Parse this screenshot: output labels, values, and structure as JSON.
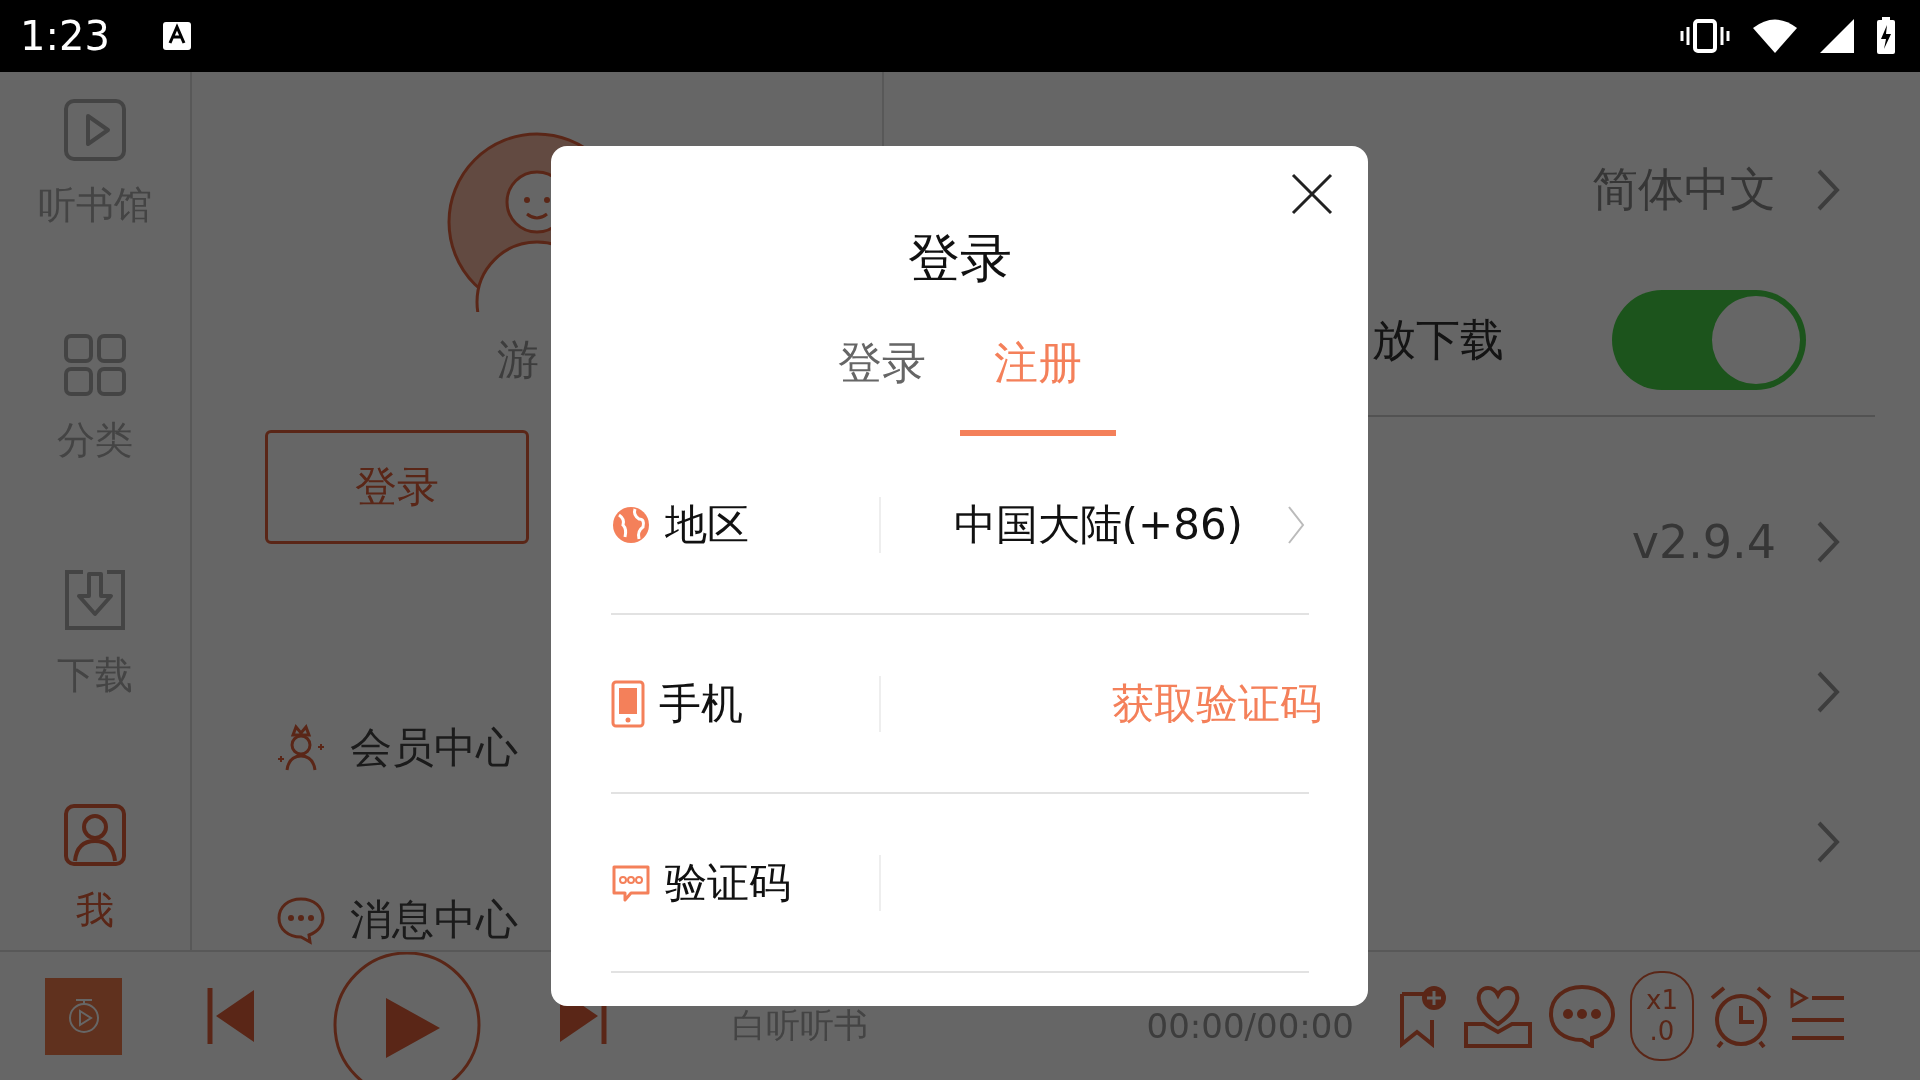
{
  "status_bar": {
    "time": "1:23"
  },
  "sidebar": {
    "items": [
      {
        "label": "听书馆",
        "selected": false
      },
      {
        "label": "分类",
        "selected": false
      },
      {
        "label": "下载",
        "selected": false
      },
      {
        "label": "我",
        "selected": true
      }
    ]
  },
  "profile": {
    "name": "游",
    "login_button": "登录",
    "menu": [
      {
        "label": "会员中心"
      },
      {
        "label": "消息中心"
      }
    ]
  },
  "settings": {
    "rows": [
      {
        "kind": "value",
        "value": "简体中文"
      },
      {
        "kind": "toggle",
        "label": "放下载",
        "on": true
      },
      {
        "kind": "value",
        "value": "v2.9.4"
      },
      {
        "kind": "link"
      },
      {
        "kind": "link"
      }
    ]
  },
  "player": {
    "title": "白听听书",
    "time": "00:00/00:00",
    "speed": "x1\n.0"
  },
  "dialog": {
    "title": "登录",
    "tabs": [
      {
        "label": "登录",
        "selected": false
      },
      {
        "label": "注册",
        "selected": true
      }
    ],
    "fields": [
      {
        "kind": "region",
        "label": "地区",
        "value": "中国大陆(+86)"
      },
      {
        "kind": "phone",
        "label": "手机",
        "action": "获取验证码"
      },
      {
        "kind": "code",
        "label": "验证码"
      }
    ]
  }
}
